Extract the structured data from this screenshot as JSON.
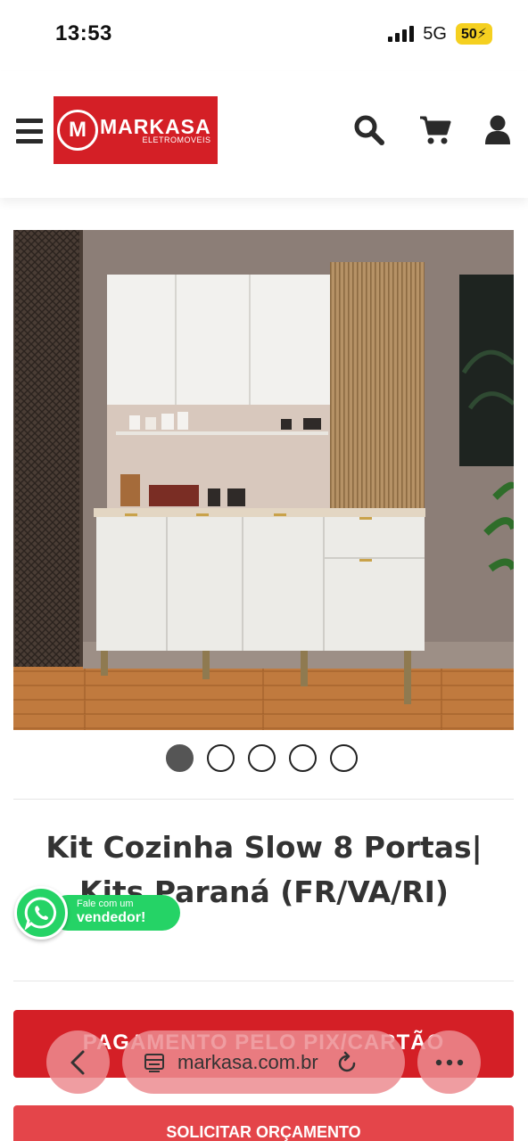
{
  "status_bar": {
    "time": "13:53",
    "network": "5G",
    "battery": "50"
  },
  "header": {
    "logo": {
      "mark": "M",
      "name": "MARKASA",
      "subtitle": "ELETROMOVEIS"
    },
    "icons": [
      "menu-icon",
      "search-icon",
      "cart-icon",
      "user-icon"
    ]
  },
  "product": {
    "title": "Kit Cozinha Slow 8 Portas| Kits Paraná (FR/VA/RI)",
    "carousel": {
      "count": 5,
      "active": 1
    }
  },
  "whatsapp": {
    "small": "Fale com um",
    "big": "vendedor!"
  },
  "buttons": {
    "buy": "PAGAMENTO PELO PIX/CARTÃO",
    "quote": "SOLICITAR ORÇAMENTO"
  },
  "browser": {
    "url": "markasa.com.br"
  },
  "colors": {
    "brand": "#d41f26",
    "whatsapp": "#25d366",
    "text": "#333333"
  }
}
